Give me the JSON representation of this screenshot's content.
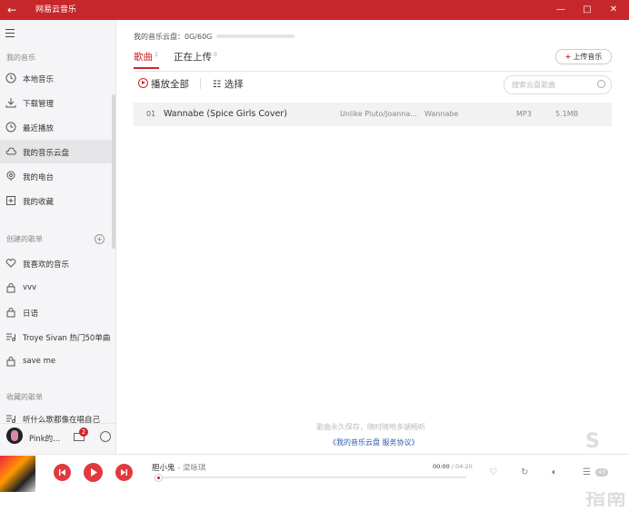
{
  "window": {
    "title": "网易云音乐",
    "back_glyph": "←",
    "min_glyph": "—",
    "max_glyph": "□",
    "close_glyph": "✕"
  },
  "colors": {
    "accent": "#c6272b",
    "sidebar_bg": "#f5f5f7"
  },
  "sidebar": {
    "my_music_header": "我的音乐",
    "my_music": [
      {
        "label": "本地音乐",
        "icon": "local-music-icon"
      },
      {
        "label": "下载管理",
        "icon": "download-icon"
      },
      {
        "label": "最近播放",
        "icon": "clock-icon"
      },
      {
        "label": "我的音乐云盘",
        "icon": "cloud-icon",
        "active": true
      },
      {
        "label": "我的电台",
        "icon": "radio-icon"
      },
      {
        "label": "我的收藏",
        "icon": "collection-icon"
      }
    ],
    "created_header": "创建的歌单",
    "created": [
      {
        "label": "我喜欢的音乐",
        "icon": "heart-icon"
      },
      {
        "label": "vvv",
        "icon": "lock-icon"
      },
      {
        "label": "日语",
        "icon": "lock-icon"
      },
      {
        "label": "Troye Sivan 热门50单曲",
        "icon": "playlist-icon"
      },
      {
        "label": "save me",
        "icon": "lock-icon"
      }
    ],
    "collected_header": "收藏的歌单",
    "collected_partial": "听什么歌都像在唱自己",
    "user": {
      "name": "Pink的...",
      "badge": "2"
    }
  },
  "main": {
    "cloud_info": "我的音乐云盘：0G/60G",
    "tabs": [
      {
        "label": "歌曲",
        "count": "1"
      },
      {
        "label": "正在上传",
        "count": "0"
      }
    ],
    "upload_label": "上传音乐",
    "play_all": "播放全部",
    "select": "选择",
    "search_placeholder": "搜索云盘歌曲",
    "songs": [
      {
        "no": "01",
        "title": "Wannabe (Spice Girls Cover)",
        "artist": "Unlike Pluto/Joanna...",
        "album": "Wannabe",
        "format": "MP3",
        "size": "5.1MB"
      }
    ],
    "footer_note": "歌曲永久保存，随时随地多端畅听",
    "footer_link": "《我的音乐云盘 服务协议》",
    "watermark": "S 搜狗指南"
  },
  "player": {
    "song": "胆小鬼",
    "artist": " - 梁咏琪",
    "time_current": "00:00",
    "time_total": " / 04:20",
    "progress": 0.0,
    "playlist_count": "43"
  }
}
